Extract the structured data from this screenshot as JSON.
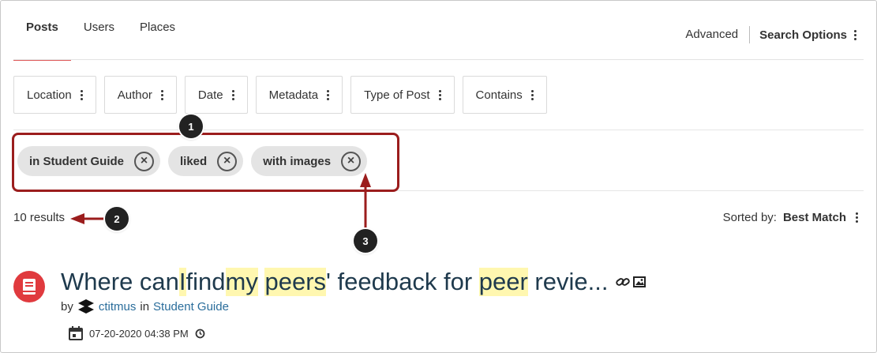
{
  "tabs": [
    {
      "label": "Posts",
      "active": true
    },
    {
      "label": "Users",
      "active": false
    },
    {
      "label": "Places",
      "active": false
    }
  ],
  "header": {
    "advanced_label": "Advanced",
    "search_options_label": "Search Options"
  },
  "filters": [
    {
      "label": "Location"
    },
    {
      "label": "Author"
    },
    {
      "label": "Date"
    },
    {
      "label": "Metadata"
    },
    {
      "label": "Type of Post"
    },
    {
      "label": "Contains"
    }
  ],
  "active_filters": [
    {
      "label": "in Student Guide"
    },
    {
      "label": "liked"
    },
    {
      "label": "with images"
    }
  ],
  "callouts": [
    "1",
    "2",
    "3"
  ],
  "results": {
    "count_label": "10 results",
    "sorted_by_label": "Sorted by:",
    "sort_value": "Best Match"
  },
  "result_item": {
    "title_parts": [
      "Where can ",
      "I",
      " find ",
      "my",
      " ",
      "peers",
      "' feedback for ",
      "peer",
      " revie..."
    ],
    "by_label": "by",
    "author": "ctitmus",
    "in_label": "in",
    "place": "Student Guide",
    "date": "07-20-2020 04:38 PM"
  },
  "colors": {
    "active_tab_underline": "#e05d5d",
    "highlight_box": "#9b1d1d",
    "arrow": "#9b1d1d",
    "post_icon_bg": "#e03a3e",
    "title_color": "#1f3a4d",
    "link_color": "#2a6d9b",
    "search_highlight": "#fff7b0"
  },
  "icons": {
    "post_type": "book-icon",
    "has_link": "link-icon",
    "has_image": "image-icon",
    "author_avatar": "avatar-icon",
    "date": "calendar-icon",
    "time": "clock-icon",
    "remove_filter": "close-circle-icon",
    "more": "kebab-icon"
  }
}
